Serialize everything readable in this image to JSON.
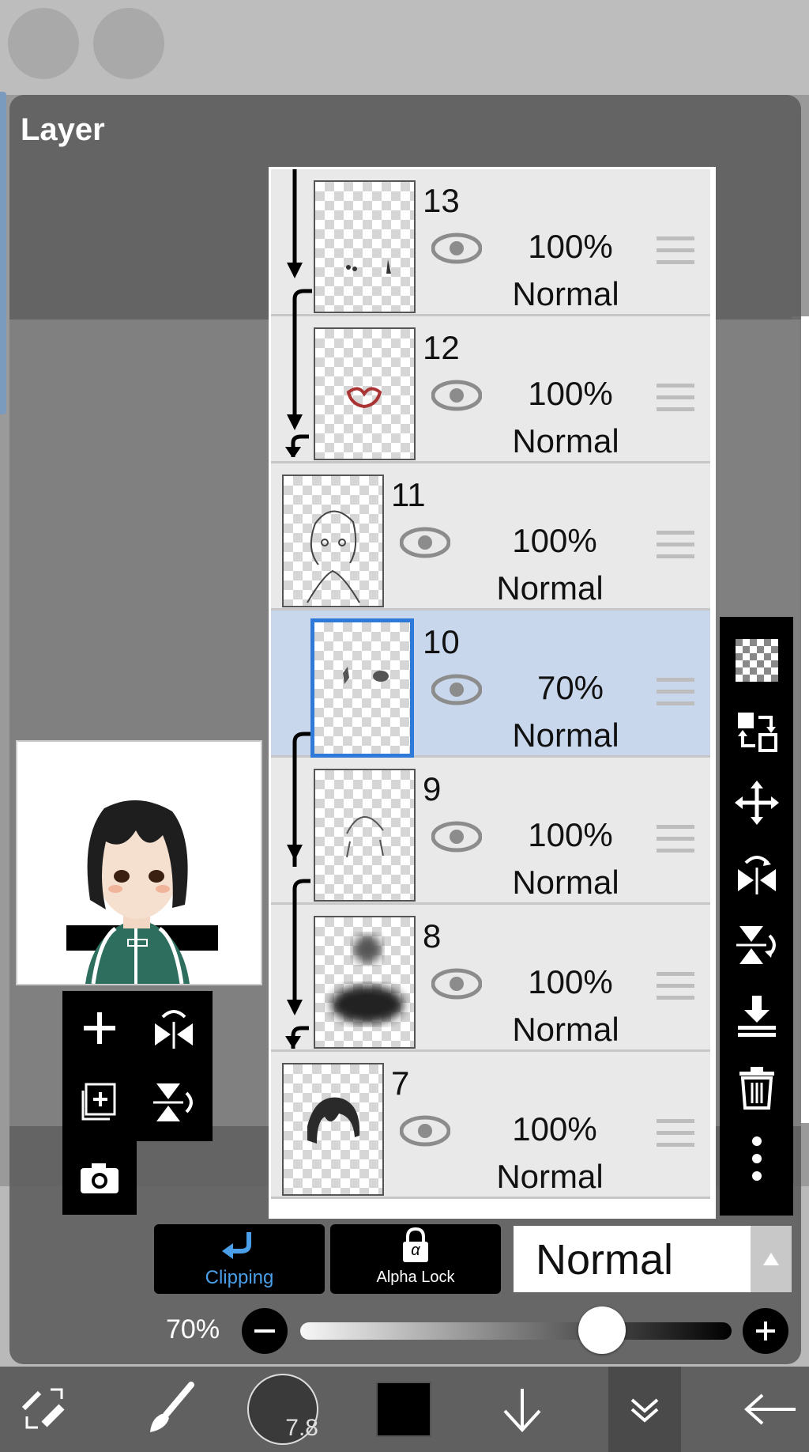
{
  "panel": {
    "title": "Layer"
  },
  "layers": [
    {
      "number": "13",
      "opacity": "100%",
      "mode": "Normal"
    },
    {
      "number": "12",
      "opacity": "100%",
      "mode": "Normal"
    },
    {
      "number": "11",
      "opacity": "100%",
      "mode": "Normal"
    },
    {
      "number": "10",
      "opacity": "70%",
      "mode": "Normal"
    },
    {
      "number": "9",
      "opacity": "100%",
      "mode": "Normal"
    },
    {
      "number": "8",
      "opacity": "100%",
      "mode": "Normal"
    },
    {
      "number": "7",
      "opacity": "100%",
      "mode": "Normal"
    }
  ],
  "layer_options": {
    "clipping_label": "Clipping",
    "alpha_lock_label": "Alpha Lock",
    "alpha_glyph": "α",
    "blend_mode": "Normal"
  },
  "opacity_control": {
    "label": "70%",
    "value_fraction": 0.7
  },
  "toolbar": {
    "brush_size": "7.8"
  },
  "colors": {
    "selected_border": "#2f7ad8",
    "clipping_accent": "#4a9fe8",
    "selected_row": "#c9d7ec"
  }
}
